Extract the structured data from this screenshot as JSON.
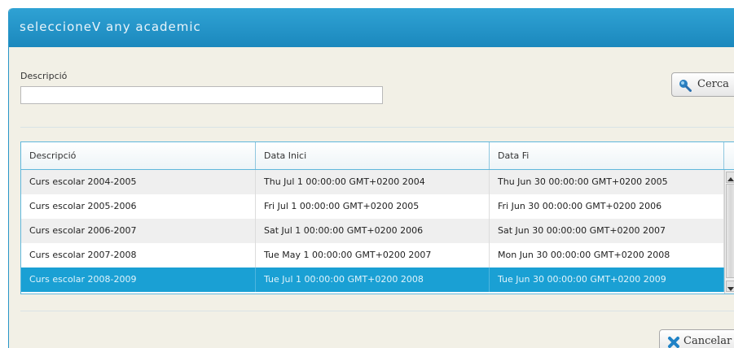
{
  "dialog": {
    "title": "seleccioneV any academic"
  },
  "filter": {
    "label": "Descripció",
    "value": "",
    "placeholder": ""
  },
  "buttons": {
    "search_label": "Cerca",
    "search_icon": "search-icon",
    "cancel_label": "Cancelar",
    "cancel_icon": "close-icon"
  },
  "colors": {
    "titlebar": "#1b88bd",
    "selection": "#1aa0d4",
    "background": "#f2f0e6"
  },
  "table": {
    "columns": [
      "Descripció",
      "Data Inici",
      "Data Fi"
    ],
    "rows": [
      {
        "descripcio": "Curs escolar 2004-2005",
        "data_inici": "Thu Jul 1 00:00:00 GMT+0200 2004",
        "data_fi": "Thu Jun 30 00:00:00 GMT+0200 2005"
      },
      {
        "descripcio": "Curs escolar 2005-2006",
        "data_inici": "Fri Jul 1 00:00:00 GMT+0200 2005",
        "data_fi": "Fri Jun 30 00:00:00 GMT+0200 2006"
      },
      {
        "descripcio": "Curs escolar 2006-2007",
        "data_inici": "Sat Jul 1 00:00:00 GMT+0200 2006",
        "data_fi": "Sat Jun 30 00:00:00 GMT+0200 2007"
      },
      {
        "descripcio": "Curs escolar 2007-2008",
        "data_inici": "Tue May 1 00:00:00 GMT+0200 2007",
        "data_fi": "Mon Jun 30 00:00:00 GMT+0200 2008"
      },
      {
        "descripcio": "Curs escolar 2008-2009",
        "data_inici": "Tue Jul 1 00:00:00 GMT+0200 2008",
        "data_fi": "Tue Jun 30 00:00:00 GMT+0200 2009"
      }
    ],
    "selected_row": 4
  }
}
